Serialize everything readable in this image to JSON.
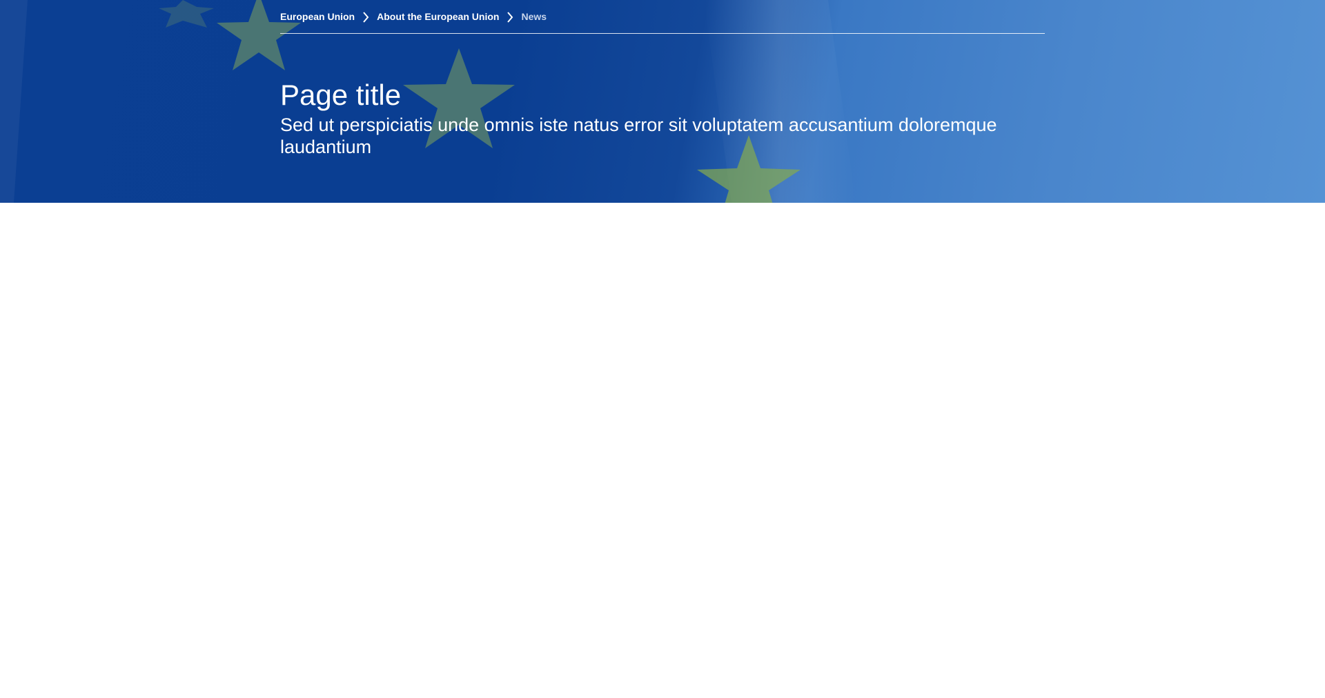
{
  "breadcrumb": {
    "items": [
      {
        "label": "European Union"
      },
      {
        "label": "About the European Union"
      },
      {
        "label": "News"
      }
    ]
  },
  "hero": {
    "title": "Page title",
    "subtitle": "Sed ut perspiciatis unde omnis iste natus error sit voluptatem accusantium doloremque laudantium"
  },
  "colors": {
    "hero_dark_blue": "#0a3e92",
    "hero_light_blue": "#5592d4",
    "star_yellow_green": "#8fb24a",
    "text_white": "#ffffff",
    "current_crumb": "#c9d6ec"
  },
  "icons": {
    "breadcrumb_separator": "chevron-right-icon"
  }
}
